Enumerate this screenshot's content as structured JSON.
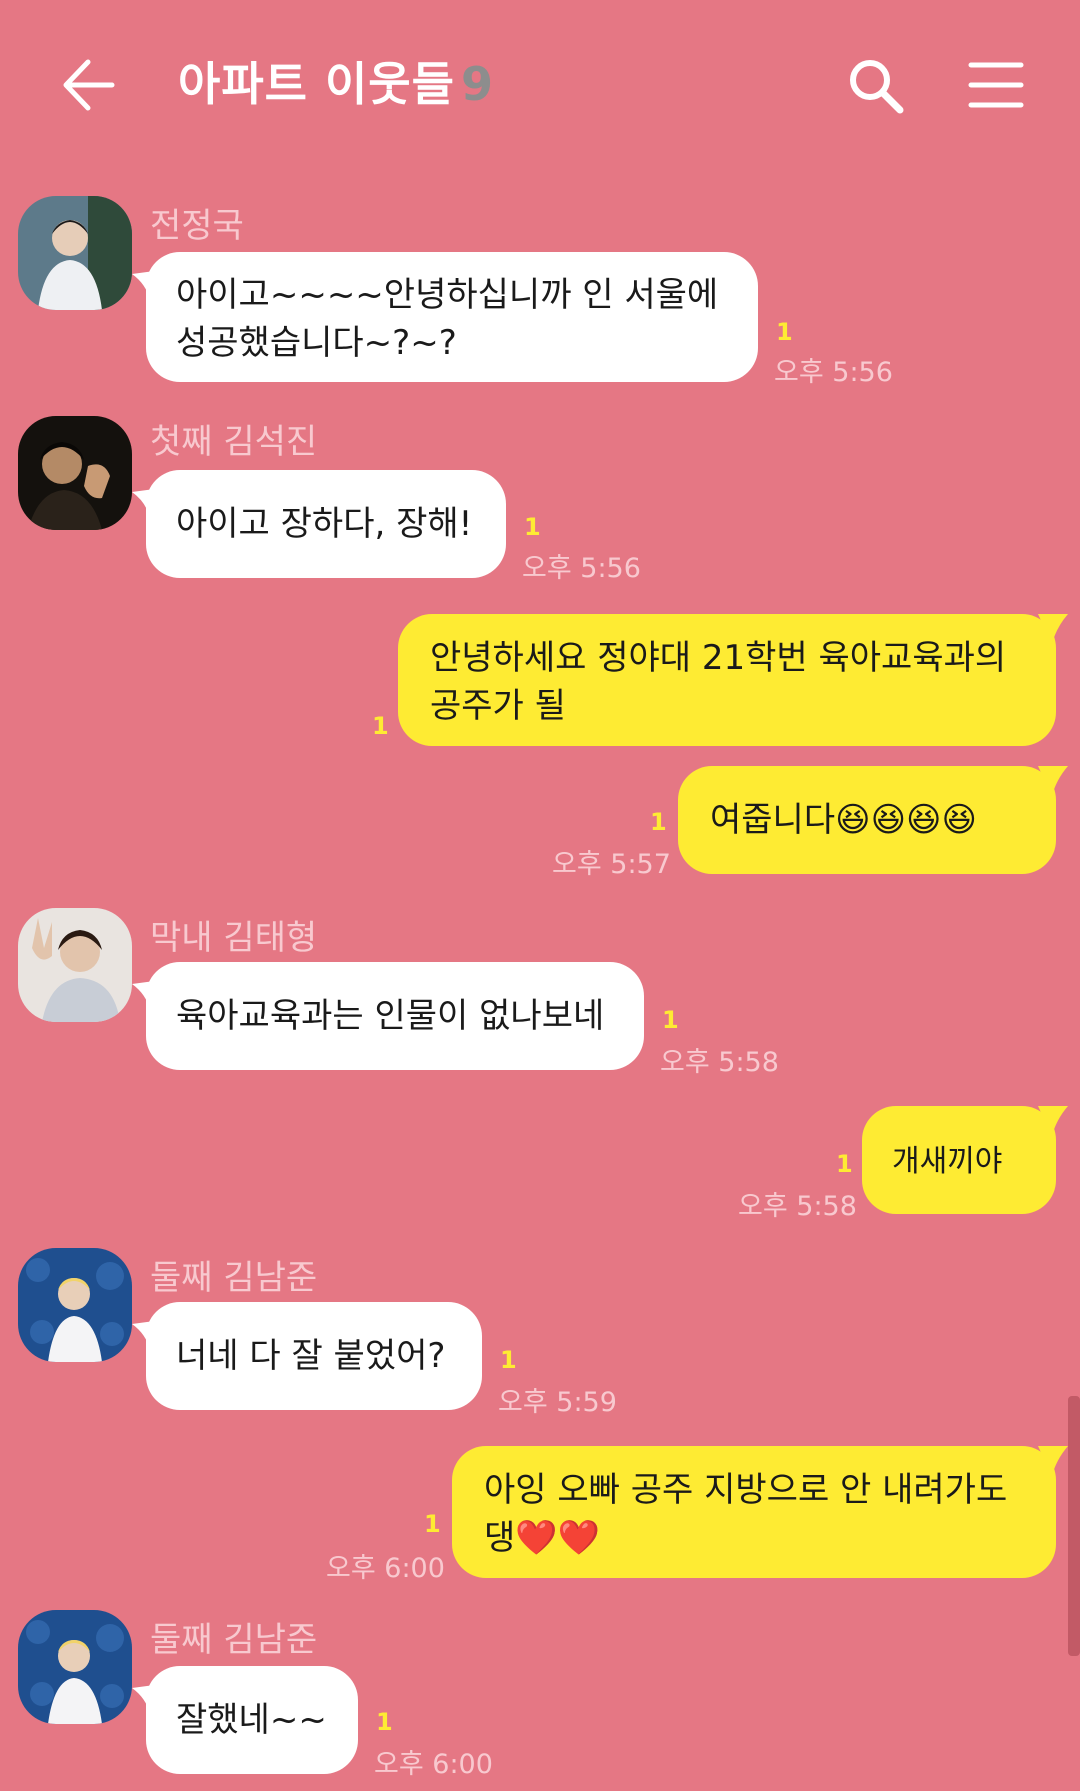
{
  "header": {
    "title": "아파트 이웃들",
    "member_count": "9",
    "back_icon": "arrow-left-icon",
    "search_icon": "search-icon",
    "menu_icon": "hamburger-menu-icon"
  },
  "colors": {
    "background": "#E57784",
    "my_bubble": "#FEEB33",
    "their_bubble": "#FFFFFF",
    "unread_count": "#FEEB33",
    "meta_text": "#F8C9CF"
  },
  "messages": [
    {
      "sender": "전정국",
      "text": "아이고~~~~안녕하십니까 인 서울에\n성공했습니다~?~?",
      "unread": "1",
      "time": "오후 5:56"
    },
    {
      "sender": "첫째 김석진",
      "text": "아이고 장하다, 장해!",
      "unread": "1",
      "time": "오후 5:56"
    },
    {
      "sender": "me",
      "text": "안녕하세요 정야대 21학번 육아교육과의\n공주가 될",
      "unread": "1",
      "time": ""
    },
    {
      "sender": "me",
      "text": "여줍니다😆😆😆😆",
      "unread": "1",
      "time": "오후 5:57"
    },
    {
      "sender": "막내 김태형",
      "text": "육아교육과는 인물이 없나보네",
      "unread": "1",
      "time": "오후 5:58"
    },
    {
      "sender": "me",
      "text": "개새끼야",
      "unread": "1",
      "time": "오후 5:58"
    },
    {
      "sender": "둘째 김남준",
      "text": "너네 다 잘 붙었어?",
      "unread": "1",
      "time": "오후 5:59"
    },
    {
      "sender": "me",
      "text": "아잉 오빠 공주 지방으로 안 내려가도\n댕❤️❤️",
      "unread": "1",
      "time": "오후 6:00"
    },
    {
      "sender": "둘째 김남준",
      "text": "잘했네~~",
      "unread": "1",
      "time": "오후 6:00"
    }
  ]
}
